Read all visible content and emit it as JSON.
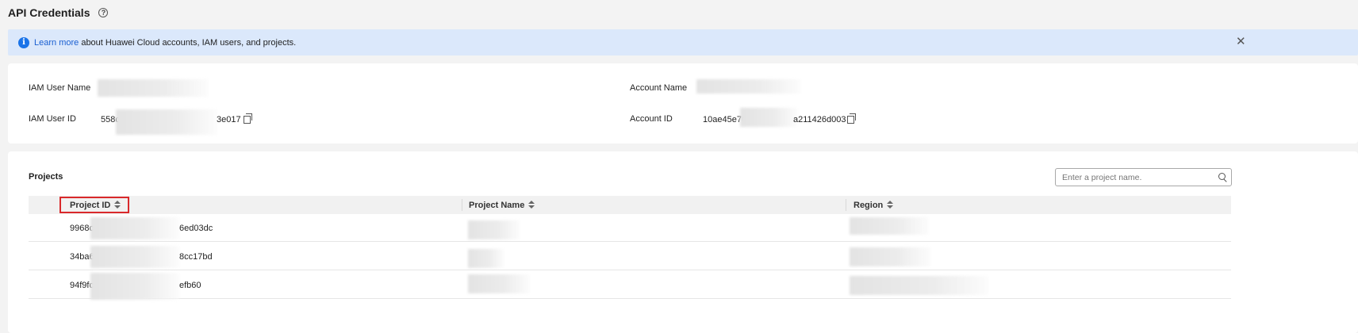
{
  "page": {
    "title": "API Credentials"
  },
  "notice": {
    "link": "Learn more",
    "text": " about Huawei Cloud accounts, IAM users, and projects."
  },
  "info": {
    "iam_user_name_label": "IAM User Name",
    "iam_user_id_label": "IAM User ID",
    "iam_user_id_prefix": "558c",
    "iam_user_id_suffix": "3e017",
    "account_name_label": "Account Name",
    "account_id_label": "Account ID",
    "account_id_prefix": "10ae45e70",
    "account_id_suffix": "a211426d003"
  },
  "projects": {
    "title": "Projects",
    "search_placeholder": "Enter a project name.",
    "columns": [
      "Project ID",
      "Project Name",
      "Region"
    ],
    "rows": [
      {
        "id_prefix": "9968c",
        "id_suffix": "6ed03dc"
      },
      {
        "id_prefix": "34ba6",
        "id_suffix": "8cc17bd"
      },
      {
        "id_prefix": "94f9fc",
        "id_suffix": "efb60"
      }
    ]
  }
}
